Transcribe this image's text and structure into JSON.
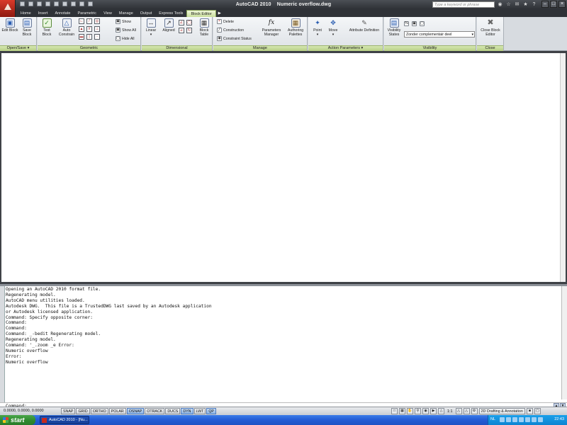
{
  "title": {
    "app_name": "AutoCAD 2010",
    "document": "Numeric overflow.dwg",
    "search_placeholder": "Type a keyword or phrase"
  },
  "tabs": [
    {
      "label": "Home"
    },
    {
      "label": "Insert"
    },
    {
      "label": "Annotate"
    },
    {
      "label": "Parametric"
    },
    {
      "label": "View"
    },
    {
      "label": "Manage"
    },
    {
      "label": "Output"
    },
    {
      "label": "Express Tools"
    },
    {
      "label": "Block Editor",
      "active": true
    }
  ],
  "ribbon": {
    "open_save": {
      "title": "Open/Save",
      "edit_block": "Edit Block",
      "save_block": "Save Block"
    },
    "geometric": {
      "title": "Geometric",
      "test_block": "Test Block",
      "auto_constrain": "Auto Constrain",
      "show": "Show",
      "show_all": "Show All",
      "hide_all": "Hide All"
    },
    "dimensional": {
      "title": "Dimensional",
      "linear": "Linear",
      "aligned": "Aligned"
    },
    "manage": {
      "title": "Manage",
      "block_table": "Block Table",
      "delete": "Delete",
      "construction": "Construction",
      "constraint_status": "Constraint Status",
      "parameters_manager": "Parameters Manager",
      "authoring_palettes": "Authoring Palettes"
    },
    "action_parameters": {
      "title": "Action Parameters",
      "point": "Point",
      "move": "Move",
      "attribute_definition": "Attribute Definition"
    },
    "visibility": {
      "title": "Visibility",
      "visibility_states": "Visibility States",
      "state_value": "Zonder complementair deel"
    },
    "close": {
      "title": "Close",
      "close_block_editor": "Close Block Editor"
    }
  },
  "command_window": {
    "history": [
      "Opening an AutoCAD 2010 format file.",
      "Regenerating model.",
      "AutoCAD menu utilities loaded.",
      "Autodesk DWG.  This file is a TrustedDWG last saved by an Autodesk application",
      "or Autodesk licensed application.",
      "Command: Specify opposite corner:",
      "Command:",
      "Command:",
      "Command: _-bedit Regenerating model.",
      "Regenerating model.",
      "Command: '_.zoom _e Error:",
      "Numeric overflow",
      "Error:",
      "Numeric overflow"
    ],
    "prompt": "Command:"
  },
  "status_bar": {
    "coordinates": "0.0000, 0.0000, 0.0000",
    "toggles": [
      {
        "label": "SNAP",
        "on": false
      },
      {
        "label": "GRID",
        "on": false
      },
      {
        "label": "ORTHO",
        "on": false
      },
      {
        "label": "POLAR",
        "on": false
      },
      {
        "label": "OSNAP",
        "on": true
      },
      {
        "label": "OTRACK",
        "on": false
      },
      {
        "label": "DUCS",
        "on": false
      },
      {
        "label": "DYN",
        "on": true
      },
      {
        "label": "LWT",
        "on": false
      },
      {
        "label": "QP",
        "on": true
      }
    ],
    "annotation_scale": "1:1",
    "workspace": "2D Drafting & Annotation"
  },
  "taskbar": {
    "start_label": "start",
    "task_label": "AutoCAD 2010 - [Nu...",
    "language": "NL",
    "clock": "22:43"
  },
  "colors": {
    "accent_tab": "#c9de9c",
    "toggle_on": "#8db4e3",
    "taskbar": "#245dd6"
  }
}
